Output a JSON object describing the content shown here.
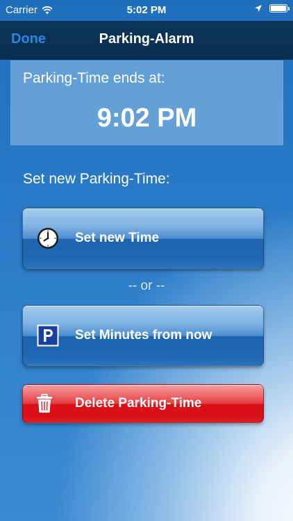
{
  "status_bar": {
    "carrier": "Carrier",
    "time": "5:02 PM",
    "icons": [
      "wifi-icon",
      "location-arrow-icon",
      "battery-icon"
    ]
  },
  "nav": {
    "done_label": "Done",
    "title": "Parking-Alarm"
  },
  "info": {
    "label": "Parking-Time ends at:",
    "end_time": "9:02 PM"
  },
  "section_label": "Set new Parking-Time:",
  "buttons": {
    "set_time": {
      "label": "Set new Time",
      "icon": "clock-icon"
    },
    "separator": "-- or --",
    "set_minutes": {
      "label": "Set Minutes from now",
      "icon": "parking-sign-icon"
    },
    "delete": {
      "label": "Delete Parking-Time",
      "icon": "trash-icon"
    }
  },
  "colors": {
    "nav_background": "#0a2f50",
    "done_accent": "#2a86e4",
    "button_blue": "#1e63ad",
    "button_red": "#d90f18",
    "parking_sign": "#1b3fa0"
  }
}
